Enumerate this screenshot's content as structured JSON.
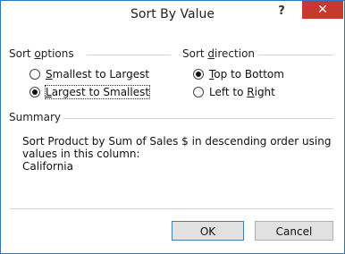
{
  "dialog": {
    "title": "Sort By Value",
    "help_icon": "?",
    "close_icon": "✕"
  },
  "sort_options": {
    "label_pre": "Sort ",
    "label_ul": "o",
    "label_post": "ptions",
    "items": [
      {
        "ul": "S",
        "rest": "mallest to Largest",
        "checked": false
      },
      {
        "ul": "L",
        "rest": "argest to Smallest",
        "checked": true
      }
    ]
  },
  "sort_direction": {
    "label_pre": "Sort ",
    "label_ul": "d",
    "label_post": "irection",
    "items": [
      {
        "ul": "T",
        "rest": "op to Bottom",
        "checked": true
      },
      {
        "pre": "Left to ",
        "ul": "R",
        "rest": "ight",
        "checked": false
      }
    ]
  },
  "summary": {
    "label": "Summary",
    "line1": "Sort Product by Sum of Sales $ in descending order using",
    "line2": "values in this column:",
    "line3": "California"
  },
  "buttons": {
    "ok": "OK",
    "cancel": "Cancel"
  }
}
